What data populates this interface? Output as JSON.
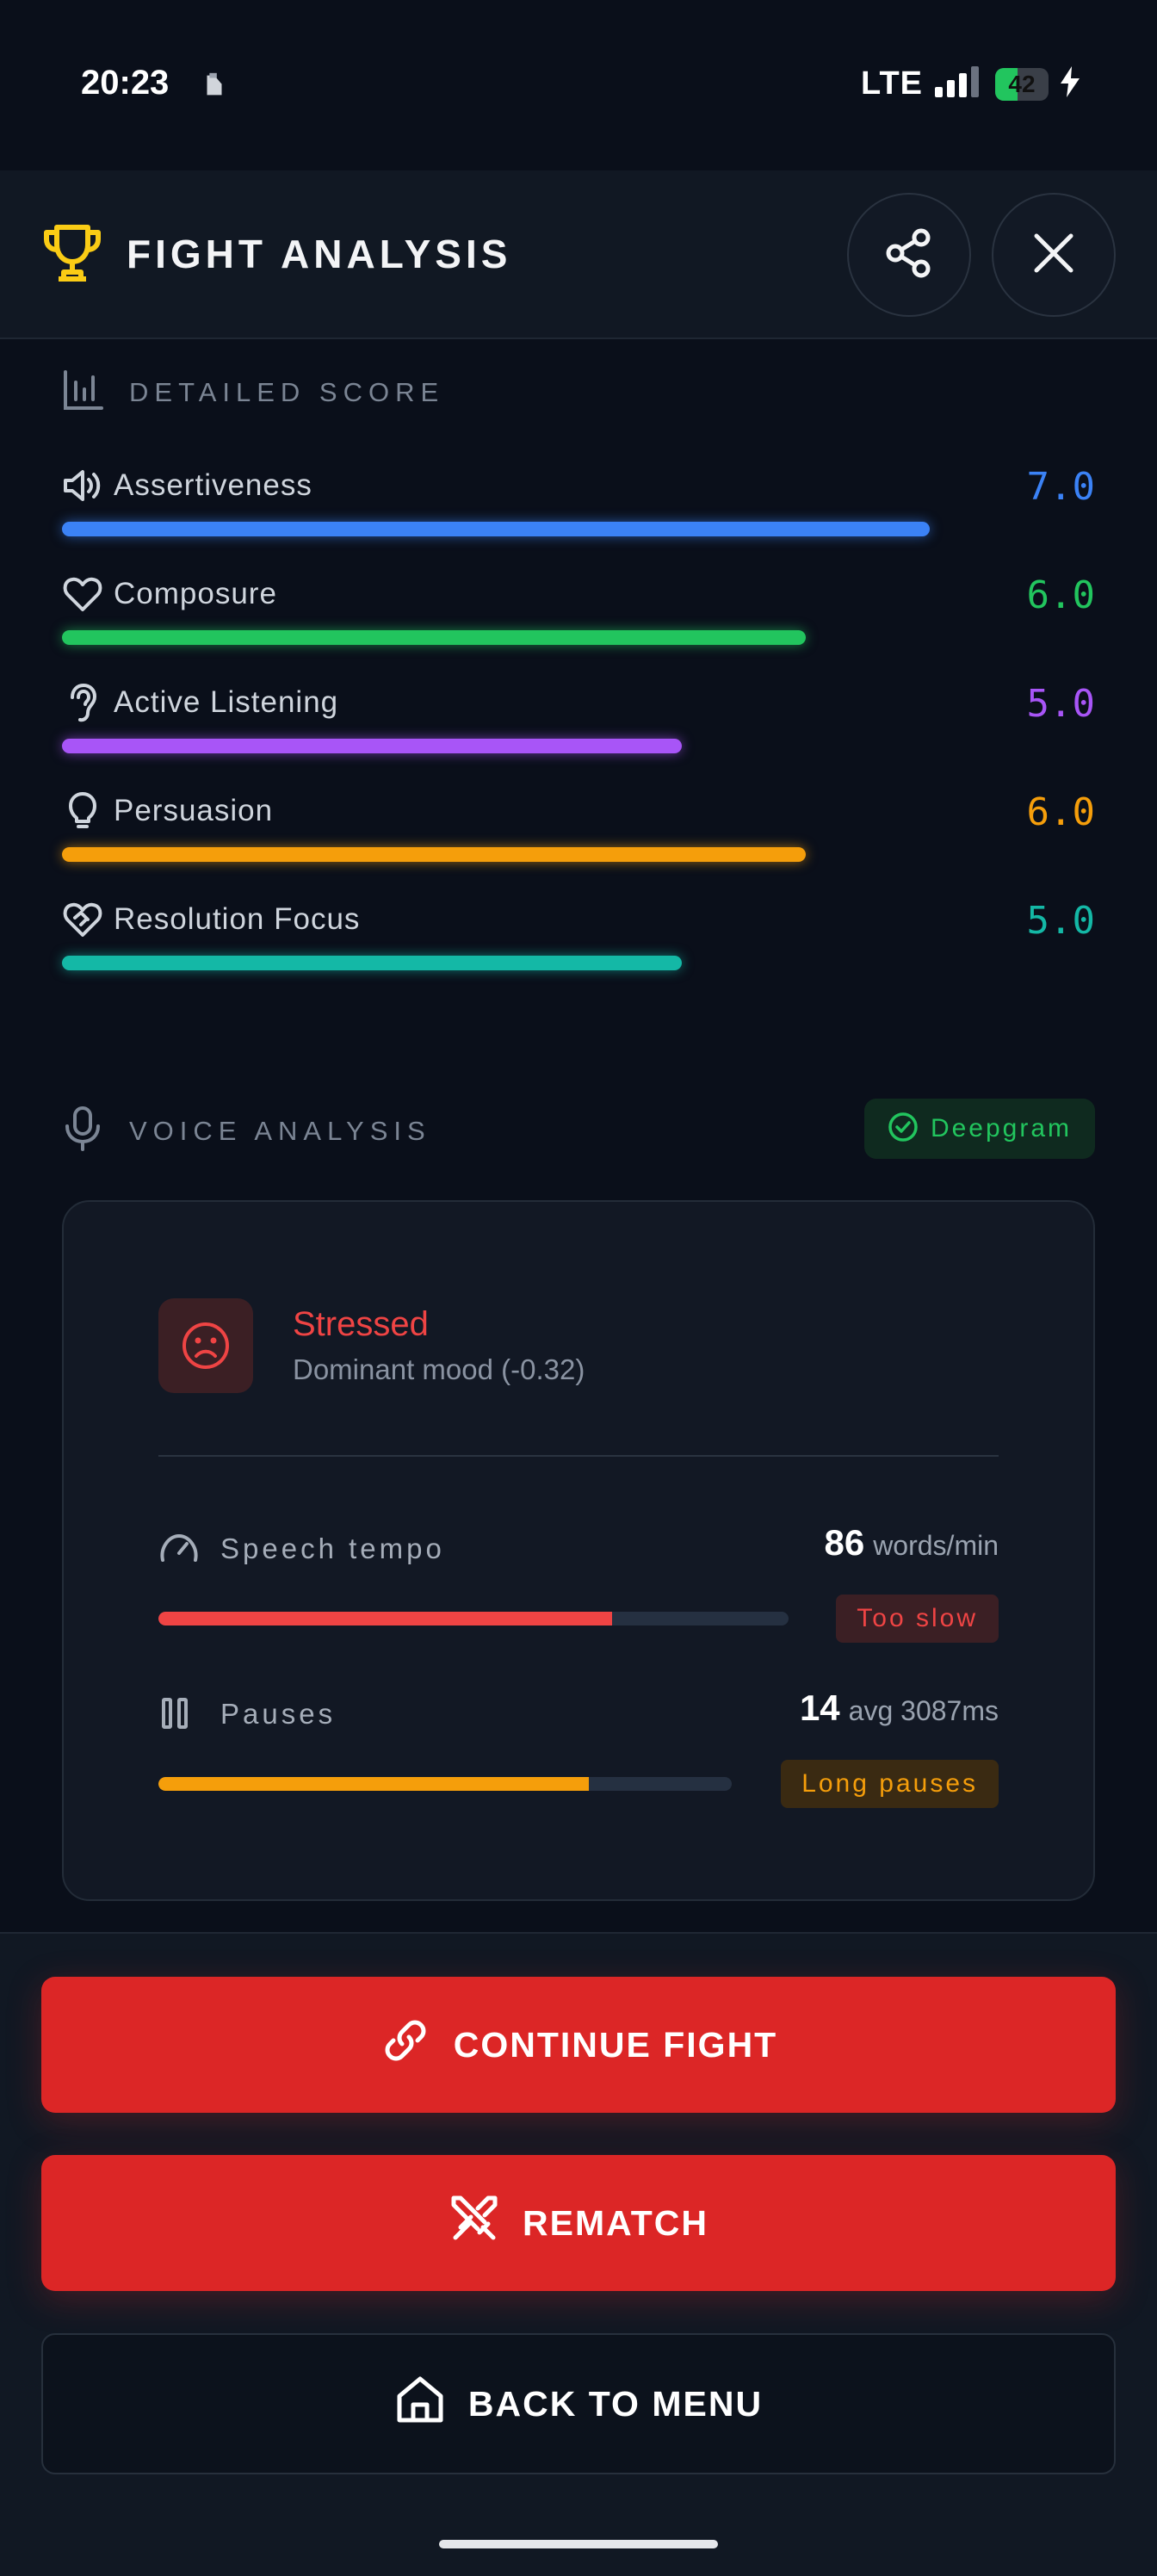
{
  "status_bar": {
    "time": "20:23",
    "network": "LTE",
    "battery": "42",
    "battery_level": 0.42
  },
  "header": {
    "title": "FIGHT ANALYSIS",
    "icons": [
      "trophy-icon",
      "share-icon",
      "close-icon"
    ]
  },
  "detailed_score": {
    "title": "DETAILED SCORE",
    "max_score": 10,
    "items": [
      {
        "label": "Assertiveness",
        "value": "7.0",
        "score": 7.0,
        "color": "#3b82f6",
        "icon": "speaker-icon"
      },
      {
        "label": "Composure",
        "value": "6.0",
        "score": 6.0,
        "color": "#22c55e",
        "icon": "heart-icon"
      },
      {
        "label": "Active Listening",
        "value": "5.0",
        "score": 5.0,
        "color": "#a855f7",
        "icon": "ear-icon"
      },
      {
        "label": "Persuasion",
        "value": "6.0",
        "score": 6.0,
        "color": "#f59e0b",
        "icon": "lightbulb-icon"
      },
      {
        "label": "Resolution Focus",
        "value": "5.0",
        "score": 5.0,
        "color": "#14b8a6",
        "icon": "handshake-heart-icon"
      }
    ]
  },
  "voice_analysis": {
    "title": "VOICE ANALYSIS",
    "provider_badge": "Deepgram",
    "mood": {
      "title": "Stressed",
      "subtitle": "Dominant mood (-0.32)"
    },
    "speech_tempo": {
      "label": "Speech tempo",
      "value": "86",
      "unit": "words/min",
      "badge": "Too slow",
      "level": 0.72,
      "color": "#ef4444"
    },
    "pauses": {
      "label": "Pauses",
      "value": "14",
      "unit": "avg 3087ms",
      "badge": "Long pauses",
      "level": 0.75,
      "color": "#f59e0b"
    }
  },
  "actions": {
    "continue_label": "CONTINUE FIGHT",
    "rematch_label": "REMATCH",
    "menu_label": "BACK TO MENU"
  }
}
